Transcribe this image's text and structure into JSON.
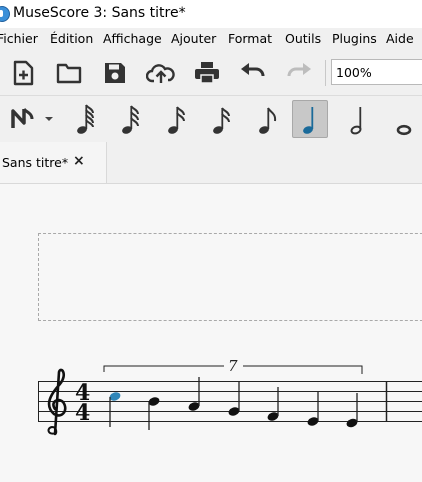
{
  "window": {
    "title": "MuseScore 3: Sans titre*"
  },
  "menubar": {
    "items": [
      "Fichier",
      "Édition",
      "Affichage",
      "Ajouter",
      "Format",
      "Outils",
      "Plugins",
      "Aide"
    ]
  },
  "toolbar": {
    "icons": [
      "new-file-icon",
      "open-folder-icon",
      "save-icon",
      "upload-cloud-icon",
      "print-icon",
      "undo-icon",
      "redo-icon"
    ],
    "zoom": "100%"
  },
  "note_input": {
    "icons": [
      "note-input-mode-icon",
      "dropdown-arrow-icon",
      "64th-note-icon",
      "32nd-note-icon",
      "16th-note-icon",
      "16th-note-alt-icon",
      "eighth-note-icon",
      "quarter-note-icon",
      "half-note-icon",
      "whole-note-icon"
    ],
    "selected": "quarter-note-icon",
    "accent_color": "#1a6a9a"
  },
  "tabs": [
    {
      "label": "Sans titre*",
      "close": "×"
    }
  ],
  "score": {
    "time_signature_top": "4",
    "time_signature_bottom": "4",
    "tuplet_number": "7",
    "selected_note_color": "#2f86b8"
  }
}
